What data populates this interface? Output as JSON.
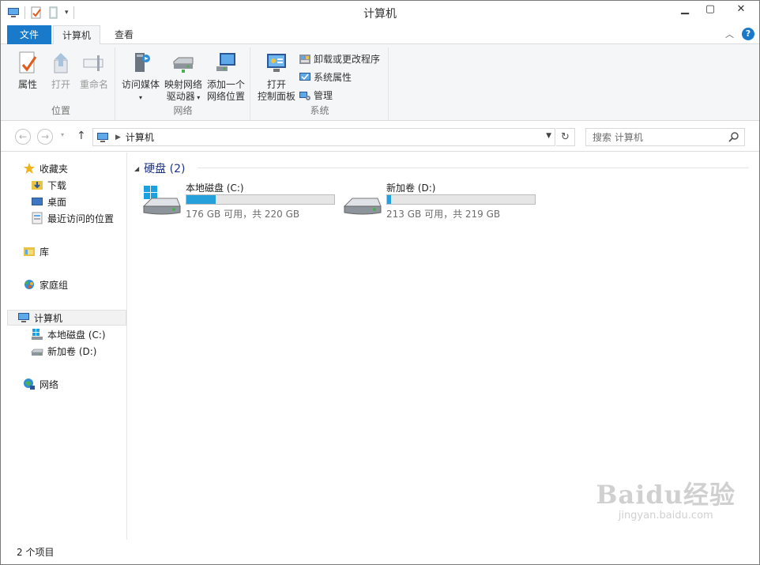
{
  "window": {
    "title": "计算机"
  },
  "tabs": {
    "file": "文件",
    "computer": "计算机",
    "view": "查看"
  },
  "ribbon": {
    "location": {
      "label": "位置",
      "properties": "属性",
      "open": "打开",
      "rename": "重命名"
    },
    "network": {
      "label": "网络",
      "access_media": "访问媒体",
      "map_drive_1": "映射网络",
      "map_drive_2": "驱动器",
      "add_location_1": "添加一个",
      "add_location_2": "网络位置"
    },
    "system": {
      "label": "系统",
      "open_cp_1": "打开",
      "open_cp_2": "控制面板",
      "uninstall": "卸载或更改程序",
      "sys_props": "系统属性",
      "manage": "管理"
    }
  },
  "address": {
    "path": "计算机",
    "search_placeholder": "搜索 计算机"
  },
  "nav": {
    "favorites": "收藏夹",
    "downloads": "下载",
    "desktop": "桌面",
    "recent": "最近访问的位置",
    "libraries": "库",
    "homegroup": "家庭组",
    "computer": "计算机",
    "drive_c": "本地磁盘 (C:)",
    "drive_d": "新加卷 (D:)",
    "network": "网络"
  },
  "content": {
    "section_title": "硬盘 (2)",
    "drives": [
      {
        "name": "本地磁盘 (C:)",
        "info": "176 GB 可用，共 220 GB",
        "used_fraction": 0.2
      },
      {
        "name": "新加卷 (D:)",
        "info": "213 GB 可用，共 219 GB",
        "used_fraction": 0.027
      }
    ]
  },
  "status": {
    "count": "2 个项目"
  },
  "watermark": {
    "brand": "Baidu经验",
    "url": "jingyan.baidu.com"
  },
  "colors": {
    "accent": "#1979ca",
    "progress": "#26a0da"
  }
}
